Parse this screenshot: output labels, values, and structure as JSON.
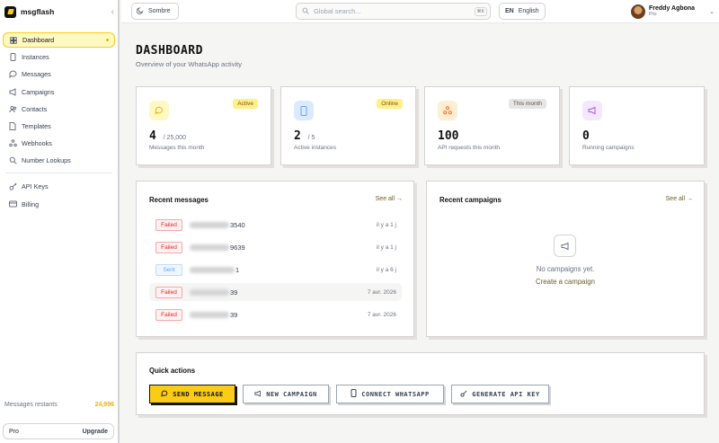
{
  "app": {
    "name": "msgflash"
  },
  "sidebar": {
    "items": [
      {
        "label": "Dashboard",
        "icon": "home-icon"
      },
      {
        "label": "Instances",
        "icon": "phone-icon"
      },
      {
        "label": "Messages",
        "icon": "chat-icon"
      },
      {
        "label": "Campaigns",
        "icon": "megaphone-icon"
      },
      {
        "label": "Contacts",
        "icon": "contacts-icon"
      },
      {
        "label": "Templates",
        "icon": "document-icon"
      },
      {
        "label": "Webhooks",
        "icon": "webhook-icon"
      },
      {
        "label": "Number Lookups",
        "icon": "search-icon"
      },
      {
        "label": "API Keys",
        "icon": "key-icon"
      },
      {
        "label": "Billing",
        "icon": "card-icon"
      }
    ],
    "quota_label": "Messages restants",
    "quota_value": "24,996",
    "plan": "Pro",
    "upgrade": "Upgrade"
  },
  "topbar": {
    "theme": "Sombre",
    "search_placeholder": "Global search...",
    "search_shortcut": "⌘K",
    "lang_code": "EN",
    "lang_name": "English",
    "user_name": "Freddy Agbona",
    "user_plan": "Pro"
  },
  "page": {
    "title": "DASHBOARD",
    "subtitle": "Overview of your WhatsApp activity"
  },
  "stats": [
    {
      "value": "4",
      "suffix": "/ 25,000",
      "caption": "Messages this month",
      "badge": "Active",
      "accent": "#facc15"
    },
    {
      "value": "2",
      "suffix": "/ 5",
      "caption": "Active instances",
      "badge": "Online",
      "accent": "#60a5fa"
    },
    {
      "value": "100",
      "suffix": "",
      "caption": "API requests this month",
      "badge": "This month",
      "accent": "#f97316"
    },
    {
      "value": "0",
      "suffix": "",
      "caption": "Running campaigns",
      "badge": "",
      "accent": "#a855f7"
    }
  ],
  "recent_messages": {
    "title": "Recent messages",
    "see_all": "See all →",
    "rows": [
      {
        "status": "Failed",
        "phone_tail": "3540",
        "time": "il y a 1 j"
      },
      {
        "status": "Failed",
        "phone_tail": "9639",
        "time": "il y a 1 j"
      },
      {
        "status": "Sent",
        "phone_tail": "1",
        "time": "il y a 6 j"
      },
      {
        "status": "Failed",
        "phone_tail": "39",
        "time": "7 avr. 2026"
      },
      {
        "status": "Failed",
        "phone_tail": "39",
        "time": "7 avr. 2026"
      }
    ]
  },
  "recent_campaigns": {
    "title": "Recent campaigns",
    "see_all": "See all →",
    "empty": "No campaigns yet.",
    "create": "Create a campaign"
  },
  "quick_actions": {
    "title": "Quick actions",
    "send": "SEND MESSAGE",
    "campaign": "NEW CAMPAIGN",
    "connect": "CONNECT WHATSAPP",
    "apikey": "GENERATE API KEY"
  }
}
